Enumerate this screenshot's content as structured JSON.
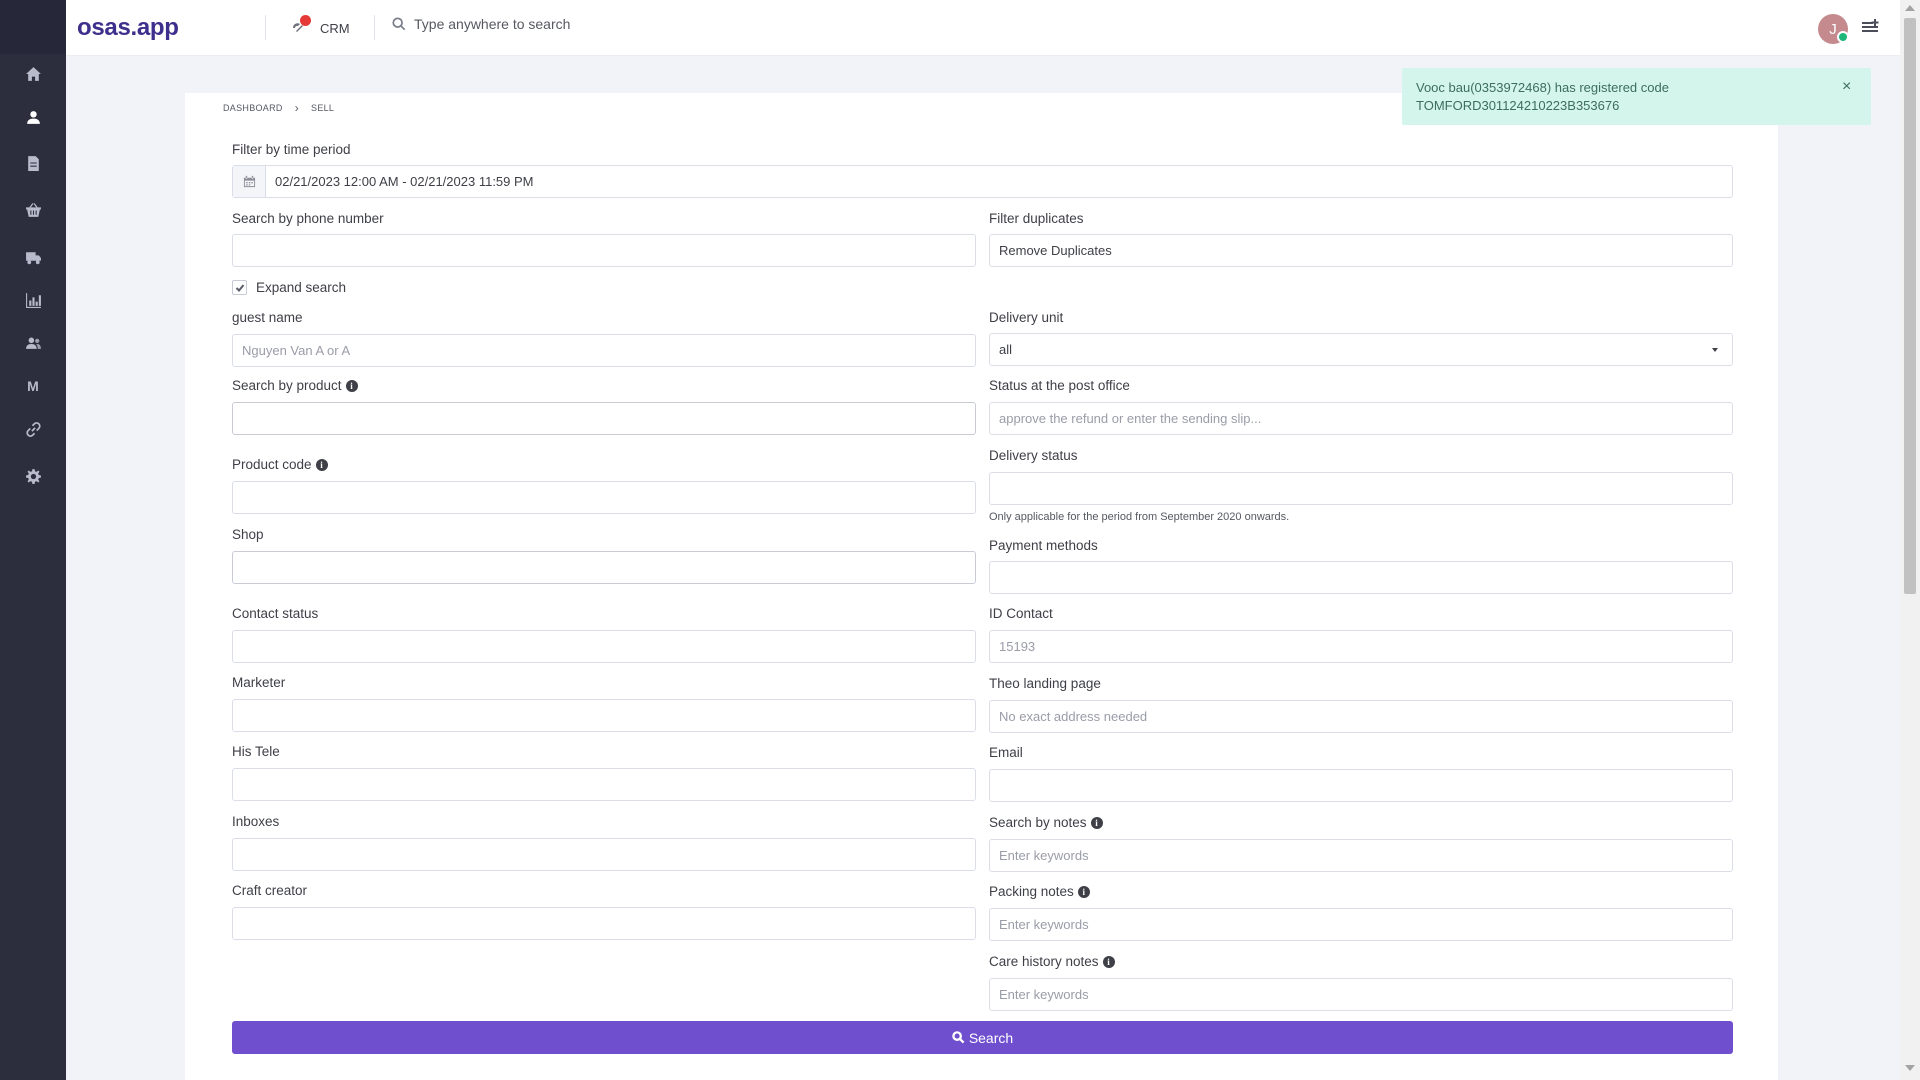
{
  "app": {
    "logo": "osas.app",
    "crm_label": "CRM",
    "search_placeholder": "Type anywhere to search",
    "avatar_initial": "J"
  },
  "sidebar": {
    "items": [
      {
        "name": "home-icon"
      },
      {
        "name": "user-icon"
      },
      {
        "name": "document-icon"
      },
      {
        "name": "basket-icon"
      },
      {
        "name": "truck-icon"
      },
      {
        "name": "chart-icon"
      },
      {
        "name": "users-icon"
      },
      {
        "name": "m-icon",
        "letter": "M"
      },
      {
        "name": "link-icon"
      },
      {
        "name": "gear-icon"
      }
    ]
  },
  "breadcrumb": {
    "home": "DASHBOARD",
    "current": "SELL"
  },
  "toast": {
    "message": "Vooc bau(0353972468) has registered code TOMFORD301124210223B353676",
    "close": "×"
  },
  "form": {
    "time_period": {
      "label": "Filter by time period",
      "value": "02/21/2023 12:00 AM - 02/21/2023 11:59 PM"
    },
    "phone": {
      "label": "Search by phone number",
      "value": ""
    },
    "duplicates": {
      "label": "Filter duplicates",
      "value": "Remove Duplicates"
    },
    "expand": {
      "label": "Expand search",
      "checked": true
    },
    "guest_name": {
      "label": "guest name",
      "placeholder": "Nguyen Van A or A"
    },
    "delivery_unit": {
      "label": "Delivery unit",
      "value": "all"
    },
    "product": {
      "label": "Search by product"
    },
    "post_status": {
      "label": "Status at the post office",
      "placeholder": "approve the refund or enter the sending slip..."
    },
    "product_code": {
      "label": "Product code"
    },
    "delivery_status": {
      "label": "Delivery status",
      "help": "Only applicable for the period from September 2020 onwards."
    },
    "shop": {
      "label": "Shop"
    },
    "payment": {
      "label": "Payment methods"
    },
    "contact_status": {
      "label": "Contact status"
    },
    "id_contact": {
      "label": "ID Contact",
      "placeholder": "15193"
    },
    "marketer": {
      "label": "Marketer"
    },
    "landing": {
      "label": "Theo landing page",
      "placeholder": "No exact address needed"
    },
    "his_tele": {
      "label": "His Tele"
    },
    "email": {
      "label": "Email"
    },
    "inboxes": {
      "label": "Inboxes"
    },
    "notes": {
      "label": "Search by notes",
      "placeholder": "Enter keywords"
    },
    "craft": {
      "label": "Craft creator"
    },
    "packing": {
      "label": "Packing notes",
      "placeholder": "Enter keywords"
    },
    "care": {
      "label": "Care history notes",
      "placeholder": "Enter keywords"
    },
    "submit": "Search"
  }
}
